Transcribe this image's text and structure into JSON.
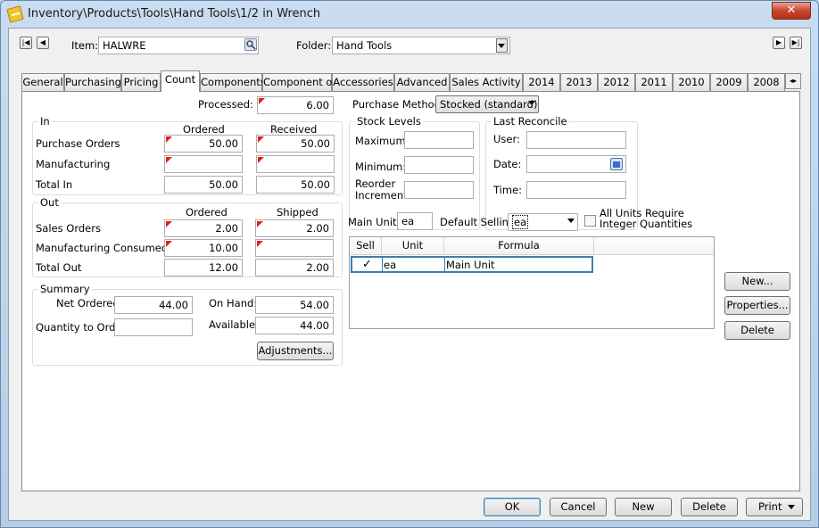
{
  "window": {
    "title": "Inventory\\Products\\Tools\\Hand Tools\\1/2 in Wrench",
    "close": "✕"
  },
  "header": {
    "item_label": "Item:",
    "item_value": "HALWRE",
    "folder_label": "Folder:",
    "folder_value": "Hand Tools"
  },
  "tabs": [
    "General",
    "Purchasing",
    "Pricing",
    "Count",
    "Components",
    "Component of",
    "Accessories",
    "Advanced",
    "Sales Activity",
    "2014",
    "2013",
    "2012",
    "2011",
    "2010",
    "2009",
    "2008"
  ],
  "count": {
    "processed_label": "Processed:",
    "processed_value": "6.00",
    "purchase_method_label": "Purchase Method:",
    "purchase_method_value": "Stocked (standard)",
    "in": {
      "legend": "In",
      "col_ordered": "Ordered",
      "col_received": "Received",
      "rows": [
        {
          "label": "Purchase Orders",
          "ordered": "50.00",
          "received": "50.00"
        },
        {
          "label": "Manufacturing",
          "ordered": "",
          "received": ""
        },
        {
          "label": "Total In",
          "ordered": "50.00",
          "received": "50.00"
        }
      ]
    },
    "out": {
      "legend": "Out",
      "col_ordered": "Ordered",
      "col_shipped": "Shipped",
      "rows": [
        {
          "label": "Sales Orders",
          "ordered": "2.00",
          "shipped": "2.00"
        },
        {
          "label": "Manufacturing Consumed",
          "ordered": "10.00",
          "shipped": ""
        },
        {
          "label": "Total Out",
          "ordered": "12.00",
          "shipped": "2.00"
        }
      ]
    },
    "summary": {
      "legend": "Summary",
      "net_ordered_label": "Net Ordered:",
      "net_ordered": "44.00",
      "on_hand_label": "On Hand:",
      "on_hand": "54.00",
      "qty_to_order_label": "Quantity to Order:",
      "qty_to_order": "",
      "available_label": "Available:",
      "available": "44.00",
      "adjustments": "Adjustments..."
    },
    "stock_levels": {
      "legend": "Stock Levels",
      "maximum": "Maximum:",
      "minimum": "Minimum:",
      "reorder_1": "Reorder",
      "reorder_2": "Increment:"
    },
    "last_reconcile": {
      "legend": "Last Reconcile",
      "user": "User:",
      "date": "Date:",
      "time": "Time:"
    },
    "units": {
      "main_unit_label": "Main Unit:",
      "main_unit_value": "ea",
      "default_selling_label": "Default Selling:",
      "default_selling_value": "ea",
      "integer_label_1": "All Units Require",
      "integer_label_2": "Integer Quantities",
      "col_sell": "Sell",
      "col_unit": "Unit",
      "col_formula": "Formula",
      "rows": [
        {
          "sell": "✓",
          "unit": "ea",
          "formula": "Main Unit"
        }
      ]
    },
    "side_buttons": {
      "new": "New...",
      "properties": "Properties...",
      "delete": "Delete"
    }
  },
  "footer": {
    "ok": "OK",
    "cancel": "Cancel",
    "new": "New",
    "delete": "Delete",
    "print": "Print"
  }
}
